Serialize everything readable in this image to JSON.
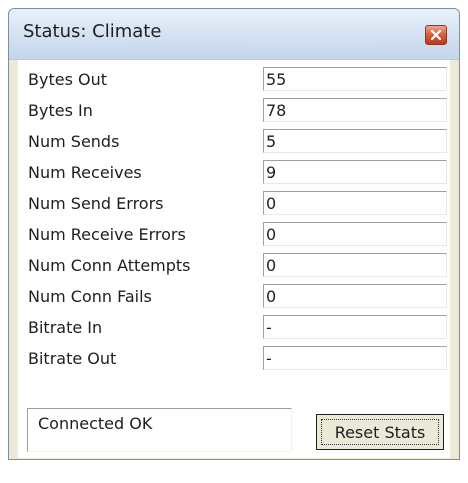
{
  "window": {
    "title": "Status: Climate"
  },
  "stats": [
    {
      "label": "Bytes Out",
      "value": "55"
    },
    {
      "label": "Bytes In",
      "value": "78"
    },
    {
      "label": "Num Sends",
      "value": "5"
    },
    {
      "label": "Num Receives",
      "value": "9"
    },
    {
      "label": "Num Send Errors",
      "value": "0"
    },
    {
      "label": "Num Receive Errors",
      "value": "0"
    },
    {
      "label": "Num Conn Attempts",
      "value": "0"
    },
    {
      "label": "Num Conn Fails",
      "value": "0"
    },
    {
      "label": "Bitrate In",
      "value": "-"
    },
    {
      "label": "Bitrate Out",
      "value": "-"
    }
  ],
  "status": {
    "text": "Connected OK"
  },
  "buttons": {
    "reset_label": "Reset Stats"
  },
  "icons": {
    "close": "close-icon"
  },
  "colors": {
    "close_button": "#d65b3d",
    "titlebar": "#d3e1f2"
  }
}
